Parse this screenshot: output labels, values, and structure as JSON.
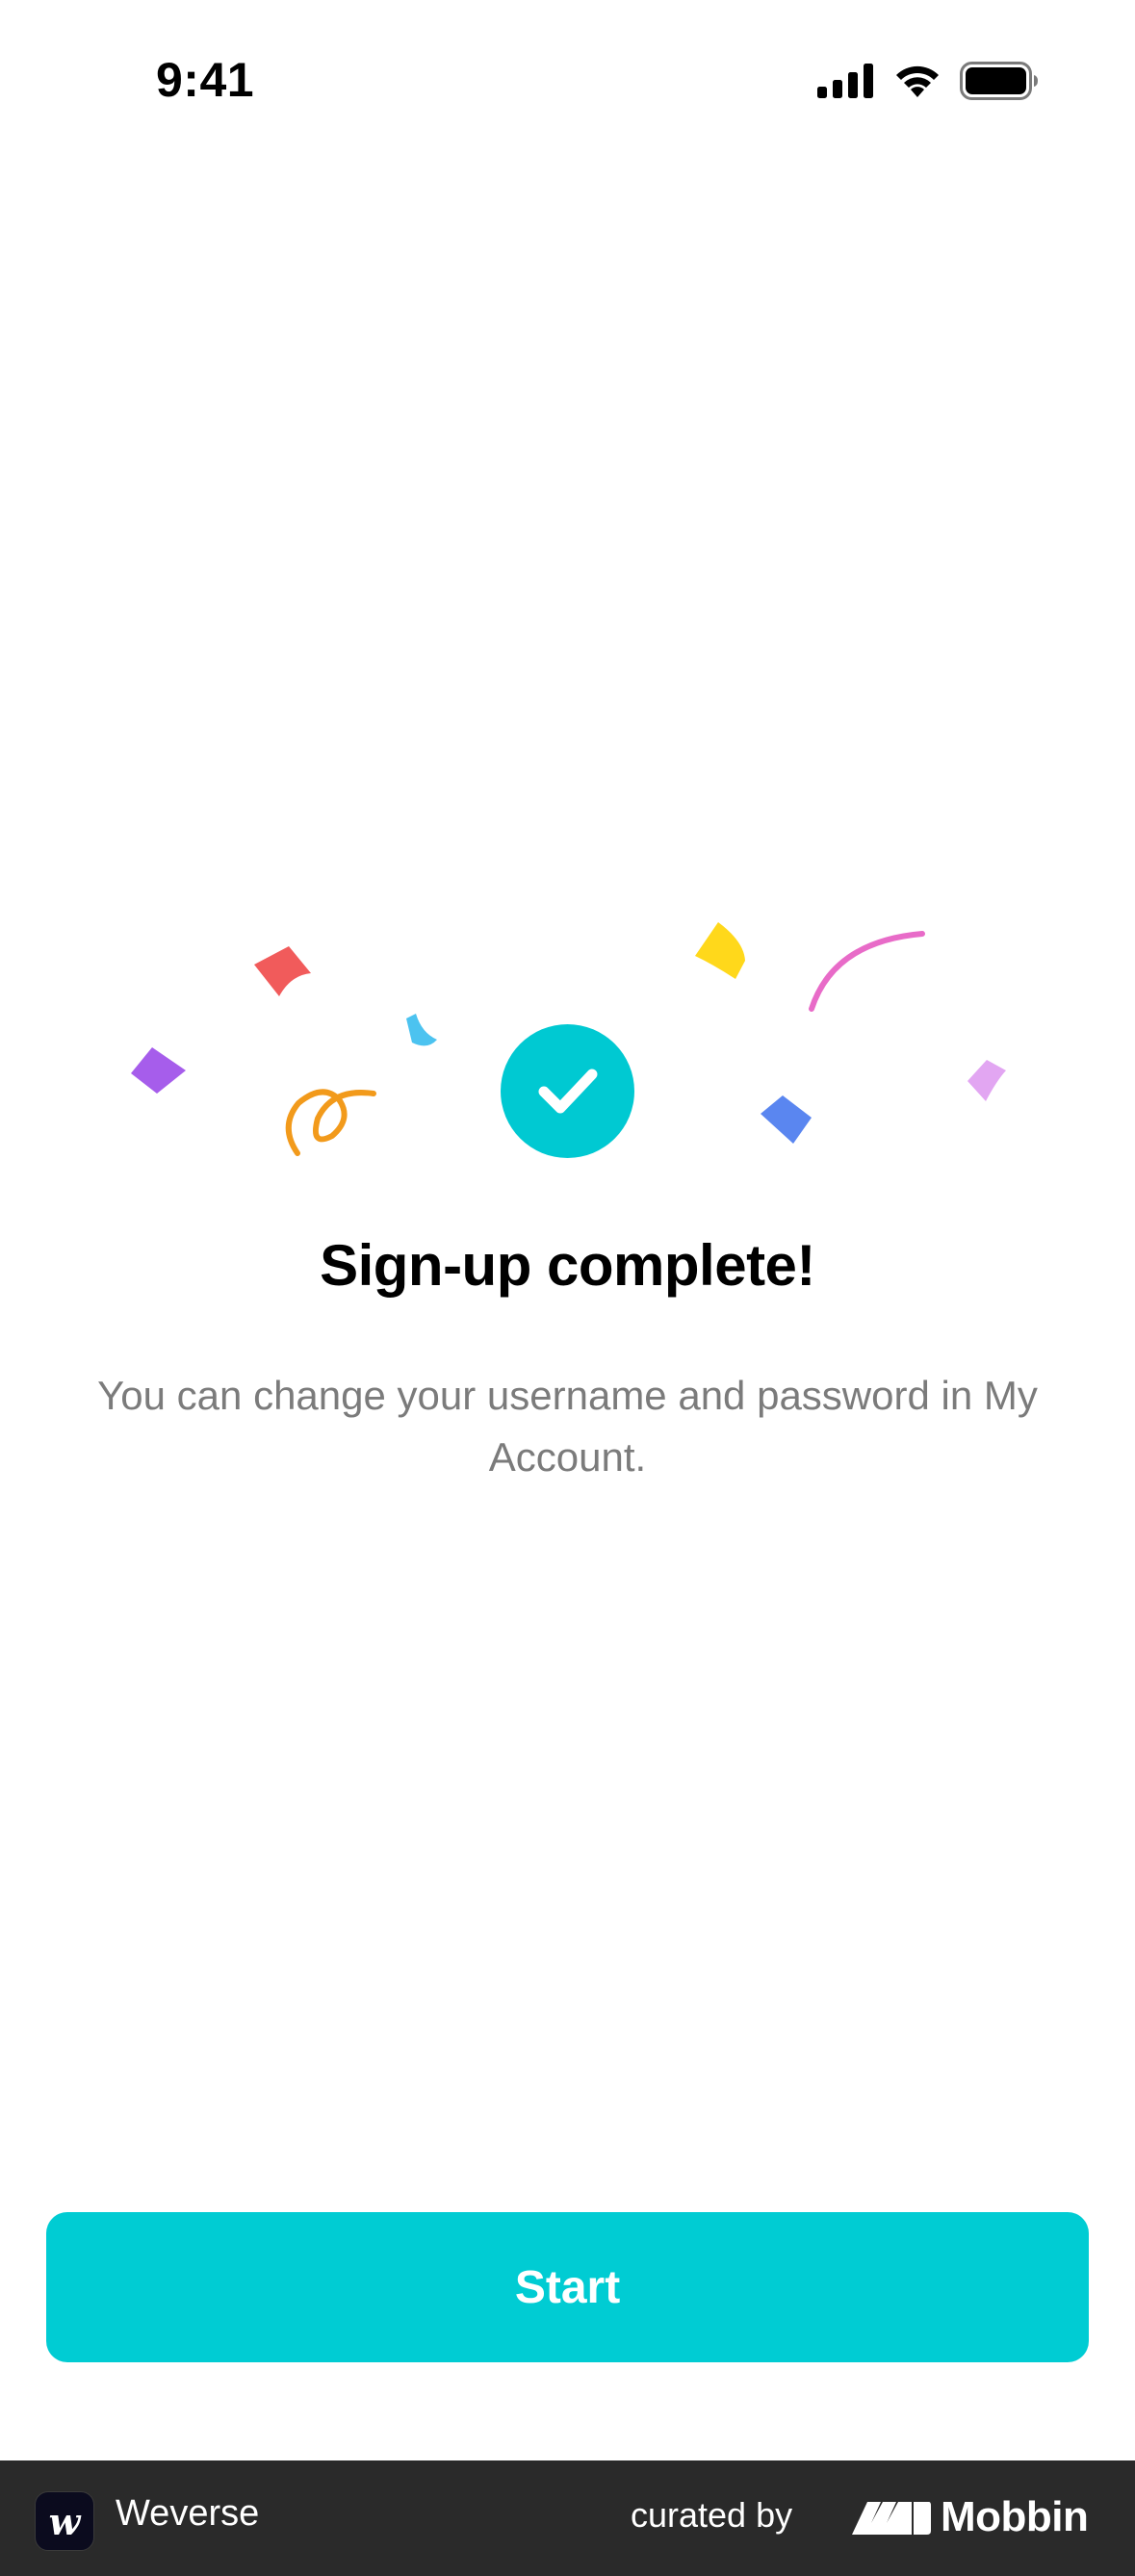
{
  "status_bar": {
    "time": "9:41",
    "icons": [
      "cellular-signal-icon",
      "wifi-icon",
      "battery-icon"
    ]
  },
  "celebration": {
    "icon": "checkmark-icon",
    "accent_color": "#00C9D2",
    "confetti_colors": [
      "#F15B5B",
      "#A65DEB",
      "#F29A1B",
      "#4CC3F0",
      "#FFD81B",
      "#E86BC8",
      "#5A86F0",
      "#E2A6F2"
    ]
  },
  "main": {
    "title": "Sign-up complete!",
    "subtitle": "You can change your username and password in My Account."
  },
  "actions": {
    "start_label": "Start",
    "button_color": "#00CCD3"
  },
  "footer": {
    "app_name": "Weverse",
    "app_badge_letter": "w",
    "curated_by": "curated by",
    "brand": "Mobbin"
  }
}
